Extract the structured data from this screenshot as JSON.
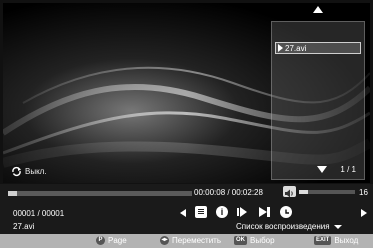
{
  "player": {
    "repeat_label": "Выкл.",
    "current_time": "00:00:08",
    "total_time": "00:02:28",
    "time_display": "00:00:08 / 00:02:28",
    "progress": 0.05,
    "volume": 16,
    "volume_level": 0.16,
    "counter": "00001 / 00001",
    "filename": "27.avi",
    "playlist_button_label": "Список воспроизведения"
  },
  "playlist": {
    "items": [
      {
        "label": "27.avi",
        "playing": true
      }
    ],
    "page": "1 / 1"
  },
  "footer": {
    "page_key": "P",
    "page_label": "Page",
    "move_label": "Переместить",
    "ok_key": "OK",
    "ok_label": "Выбор",
    "exit_key": "EXIT",
    "exit_label": "Выход"
  },
  "icons": [
    "repeat-icon",
    "volume-icon",
    "prev-icon",
    "info-list-icon",
    "info-icon",
    "step-play-icon",
    "skip-next-icon",
    "clock-icon",
    "next-icon",
    "arrows-icon"
  ]
}
